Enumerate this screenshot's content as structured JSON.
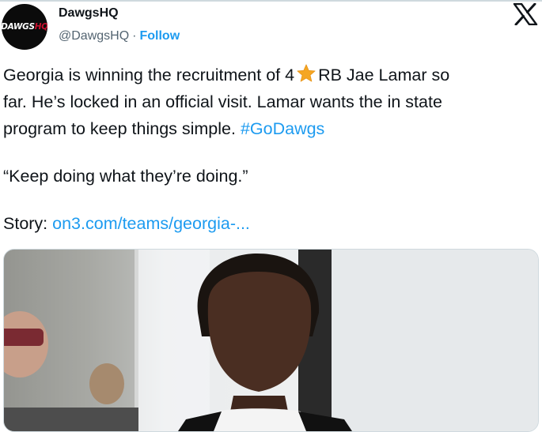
{
  "account": {
    "display_name": "DawgsHQ",
    "handle": "@DawgsHQ",
    "separator": "·",
    "follow_label": "Follow",
    "avatar_text_white": "DAWGS",
    "avatar_text_red": "HQ"
  },
  "tweet": {
    "line1_before_star": "Georgia is winning the recruitment of 4",
    "line1_after_star": "RB Jae Lamar so",
    "line2": "far. He’s locked in an official visit. Lamar wants the in state",
    "line3_text": "program to keep things simple. ",
    "hashtag": "#GoDawgs",
    "quote": "“Keep doing what they’re doing.”",
    "story_label": "Story: ",
    "story_link": "on3.com/teams/georgia-..."
  },
  "icons": {
    "star": "star-emoji-icon",
    "platform": "x-logo-icon"
  },
  "colors": {
    "link": "#1d9bf0",
    "text": "#0f1419",
    "secondary": "#536471",
    "star": "#f5a623",
    "avatar_red": "#c8102e"
  }
}
